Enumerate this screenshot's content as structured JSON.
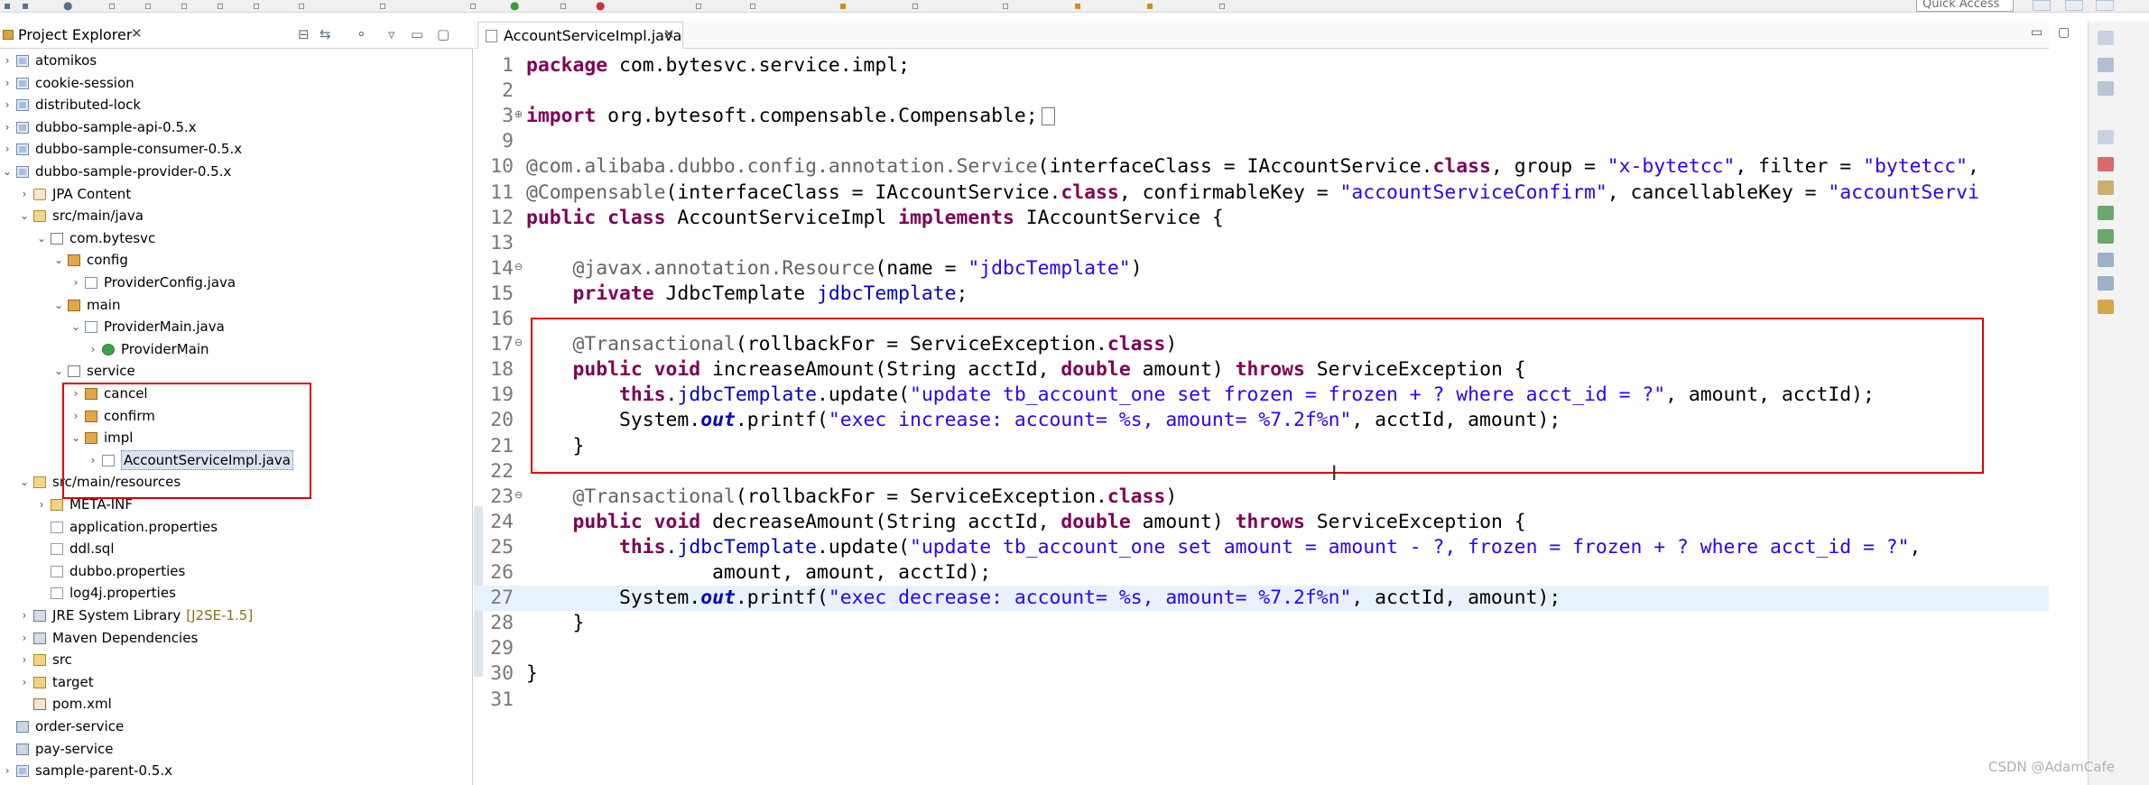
{
  "toolbar": {
    "quick_access_label": "Quick Access"
  },
  "explorer": {
    "title": "Project Explorer",
    "close_glyph": "✕",
    "tree": [
      {
        "label": "atomikos",
        "level": 0,
        "arrow": "›",
        "icon": "project"
      },
      {
        "label": "cookie-session",
        "level": 0,
        "arrow": "›",
        "icon": "project"
      },
      {
        "label": "distributed-lock",
        "level": 0,
        "arrow": "›",
        "icon": "project"
      },
      {
        "label": "dubbo-sample-api-0.5.x",
        "level": 0,
        "arrow": "›",
        "icon": "project"
      },
      {
        "label": "dubbo-sample-consumer-0.5.x",
        "level": 0,
        "arrow": "›",
        "icon": "project"
      },
      {
        "label": "dubbo-sample-provider-0.5.x",
        "level": 0,
        "arrow": "⌄",
        "icon": "project"
      },
      {
        "label": "JPA Content",
        "level": 1,
        "arrow": "›",
        "icon": "jpa"
      },
      {
        "label": "src/main/java",
        "level": 1,
        "arrow": "⌄",
        "icon": "srcfolder"
      },
      {
        "label": "com.bytesvc",
        "level": 2,
        "arrow": "⌄",
        "icon": "package"
      },
      {
        "label": "config",
        "level": 3,
        "arrow": "⌄",
        "icon": "package-filled"
      },
      {
        "label": "ProviderConfig.java",
        "level": 4,
        "arrow": "›",
        "icon": "java"
      },
      {
        "label": "main",
        "level": 3,
        "arrow": "⌄",
        "icon": "package-filled"
      },
      {
        "label": "ProviderMain.java",
        "level": 4,
        "arrow": "⌄",
        "icon": "java"
      },
      {
        "label": "ProviderMain",
        "level": 5,
        "arrow": "›",
        "icon": "class"
      },
      {
        "label": "service",
        "level": 3,
        "arrow": "⌄",
        "icon": "package"
      },
      {
        "label": "cancel",
        "level": 4,
        "arrow": "›",
        "icon": "package-filled"
      },
      {
        "label": "confirm",
        "level": 4,
        "arrow": "›",
        "icon": "package-filled"
      },
      {
        "label": "impl",
        "level": 4,
        "arrow": "⌄",
        "icon": "package-filled"
      },
      {
        "label": "AccountServiceImpl.java",
        "level": 5,
        "arrow": "›",
        "icon": "java",
        "selected": true
      },
      {
        "label": "src/main/resources",
        "level": 1,
        "arrow": "⌄",
        "icon": "srcfolder"
      },
      {
        "label": "META-INF",
        "level": 2,
        "arrow": "›",
        "icon": "folder"
      },
      {
        "label": "application.properties",
        "level": 2,
        "arrow": "",
        "icon": "file"
      },
      {
        "label": "ddl.sql",
        "level": 2,
        "arrow": "",
        "icon": "file"
      },
      {
        "label": "dubbo.properties",
        "level": 2,
        "arrow": "",
        "icon": "file"
      },
      {
        "label": "log4j.properties",
        "level": 2,
        "arrow": "",
        "icon": "file"
      },
      {
        "label": "JRE System Library",
        "decor": "[J2SE-1.5]",
        "level": 1,
        "arrow": "›",
        "icon": "lib"
      },
      {
        "label": "Maven Dependencies",
        "level": 1,
        "arrow": "›",
        "icon": "lib"
      },
      {
        "label": "src",
        "level": 1,
        "arrow": "›",
        "icon": "folder"
      },
      {
        "label": "target",
        "level": 1,
        "arrow": "›",
        "icon": "folder"
      },
      {
        "label": "pom.xml",
        "level": 1,
        "arrow": "",
        "icon": "xml"
      },
      {
        "label": "order-service",
        "level": 0,
        "arrow": "",
        "icon": "plain-project"
      },
      {
        "label": "pay-service",
        "level": 0,
        "arrow": "",
        "icon": "plain-project"
      },
      {
        "label": "sample-parent-0.5.x",
        "level": 0,
        "arrow": "›",
        "icon": "project"
      }
    ]
  },
  "editor": {
    "tab_title": "AccountServiceImpl.java",
    "close_glyph": "✕",
    "current_line": 27,
    "lines": [
      {
        "n": "1",
        "fold": "",
        "tokens": [
          [
            "kw",
            "package"
          ],
          [
            "pl",
            " com.bytesvc.service.impl;"
          ]
        ]
      },
      {
        "n": "2",
        "fold": "",
        "tokens": []
      },
      {
        "n": "3",
        "fold": "⊕",
        "tokens": [
          [
            "kw",
            "import"
          ],
          [
            "pl",
            " org.bytesoft.compensable.Compensable;"
          ]
        ],
        "collapsed": true
      },
      {
        "n": "9",
        "fold": "",
        "tokens": []
      },
      {
        "n": "10",
        "fold": "",
        "tokens": [
          [
            "ann",
            "@com.alibaba.dubbo.config.annotation.Service"
          ],
          [
            "pl",
            "(interfaceClass = IAccountService."
          ],
          [
            "kw",
            "class"
          ],
          [
            "pl",
            ", group = "
          ],
          [
            "str",
            "\"x-bytetcc\""
          ],
          [
            "pl",
            ", filter = "
          ],
          [
            "str",
            "\"bytetcc\""
          ],
          [
            "pl",
            ","
          ]
        ]
      },
      {
        "n": "11",
        "fold": "",
        "tokens": [
          [
            "ann",
            "@Compensable"
          ],
          [
            "pl",
            "(interfaceClass = IAccountService."
          ],
          [
            "kw",
            "class"
          ],
          [
            "pl",
            ", confirmableKey = "
          ],
          [
            "str",
            "\"accountServiceConfirm\""
          ],
          [
            "pl",
            ", cancellableKey = "
          ],
          [
            "str",
            "\"accountServi"
          ]
        ]
      },
      {
        "n": "12",
        "fold": "",
        "tokens": [
          [
            "kw",
            "public class"
          ],
          [
            "pl",
            " AccountServiceImpl "
          ],
          [
            "kw",
            "implements"
          ],
          [
            "pl",
            " IAccountService {"
          ]
        ]
      },
      {
        "n": "13",
        "fold": "",
        "tokens": []
      },
      {
        "n": "14",
        "fold": "⊖",
        "tokens": [
          [
            "pl",
            "    "
          ],
          [
            "ann",
            "@javax.annotation.Resource"
          ],
          [
            "pl",
            "(name = "
          ],
          [
            "str",
            "\"jdbcTemplate\""
          ],
          [
            "pl",
            ")"
          ]
        ]
      },
      {
        "n": "15",
        "fold": "",
        "tokens": [
          [
            "pl",
            "    "
          ],
          [
            "kw",
            "private"
          ],
          [
            "pl",
            " JdbcTemplate "
          ],
          [
            "fld",
            "jdbcTemplate"
          ],
          [
            "pl",
            ";"
          ]
        ]
      },
      {
        "n": "16",
        "fold": "",
        "tokens": []
      },
      {
        "n": "17",
        "fold": "⊖",
        "tokens": [
          [
            "pl",
            "    "
          ],
          [
            "ann",
            "@Transactional"
          ],
          [
            "pl",
            "(rollbackFor = ServiceException."
          ],
          [
            "kw",
            "class"
          ],
          [
            "pl",
            ")"
          ]
        ]
      },
      {
        "n": "18",
        "fold": "",
        "tokens": [
          [
            "pl",
            "    "
          ],
          [
            "kw",
            "public void"
          ],
          [
            "pl",
            " increaseAmount(String acctId, "
          ],
          [
            "kw",
            "double"
          ],
          [
            "pl",
            " amount) "
          ],
          [
            "kw",
            "throws"
          ],
          [
            "pl",
            " ServiceException {"
          ]
        ]
      },
      {
        "n": "19",
        "fold": "",
        "tokens": [
          [
            "pl",
            "        "
          ],
          [
            "kw",
            "this"
          ],
          [
            "pl",
            "."
          ],
          [
            "fld",
            "jdbcTemplate"
          ],
          [
            "pl",
            ".update("
          ],
          [
            "str",
            "\"update tb_account_one set frozen = frozen + ? where acct_id = ?\""
          ],
          [
            "pl",
            ", amount, acctId);"
          ]
        ]
      },
      {
        "n": "20",
        "fold": "",
        "tokens": [
          [
            "pl",
            "        System."
          ],
          [
            "sfld",
            "out"
          ],
          [
            "pl",
            ".printf("
          ],
          [
            "str",
            "\"exec increase: account= %s, amount= %7.2f%n\""
          ],
          [
            "pl",
            ", acctId, amount);"
          ]
        ]
      },
      {
        "n": "21",
        "fold": "",
        "tokens": [
          [
            "pl",
            "    }"
          ]
        ]
      },
      {
        "n": "22",
        "fold": "",
        "tokens": []
      },
      {
        "n": "23",
        "fold": "⊖",
        "tokens": [
          [
            "pl",
            "    "
          ],
          [
            "ann",
            "@Transactional"
          ],
          [
            "pl",
            "(rollbackFor = ServiceException."
          ],
          [
            "kw",
            "class"
          ],
          [
            "pl",
            ")"
          ]
        ]
      },
      {
        "n": "24",
        "fold": "",
        "tokens": [
          [
            "pl",
            "    "
          ],
          [
            "kw",
            "public void"
          ],
          [
            "pl",
            " decreaseAmount(String acctId, "
          ],
          [
            "kw",
            "double"
          ],
          [
            "pl",
            " amount) "
          ],
          [
            "kw",
            "throws"
          ],
          [
            "pl",
            " ServiceException {"
          ]
        ]
      },
      {
        "n": "25",
        "fold": "",
        "tokens": [
          [
            "pl",
            "        "
          ],
          [
            "kw",
            "this"
          ],
          [
            "pl",
            "."
          ],
          [
            "fld",
            "jdbcTemplate"
          ],
          [
            "pl",
            ".update("
          ],
          [
            "str",
            "\"update tb_account_one set amount = amount - ?, frozen = frozen + ? where acct_id = ?\""
          ],
          [
            "pl",
            ","
          ]
        ]
      },
      {
        "n": "26",
        "fold": "",
        "tokens": [
          [
            "pl",
            "                amount, amount, acctId);"
          ]
        ]
      },
      {
        "n": "27",
        "fold": "",
        "tokens": [
          [
            "pl",
            "        System."
          ],
          [
            "sfld",
            "out"
          ],
          [
            "pl",
            ".printf("
          ],
          [
            "str",
            "\"exec decrease: account= %s, amount= %7.2f%n\""
          ],
          [
            "pl",
            ", acctId, amount);"
          ]
        ]
      },
      {
        "n": "28",
        "fold": "",
        "tokens": [
          [
            "pl",
            "    }"
          ]
        ]
      },
      {
        "n": "29",
        "fold": "",
        "tokens": []
      },
      {
        "n": "30",
        "fold": "",
        "tokens": [
          [
            "pl",
            "}"
          ]
        ]
      },
      {
        "n": "31",
        "fold": "",
        "tokens": []
      }
    ]
  },
  "watermark": "CSDN @AdamCafe",
  "colors": {
    "keyword": "#7f0055",
    "string": "#2a00ff",
    "annotation": "#646464",
    "field": "#0000c0",
    "highlight_box": "#e00000",
    "current_line": "#e8f2fe"
  }
}
